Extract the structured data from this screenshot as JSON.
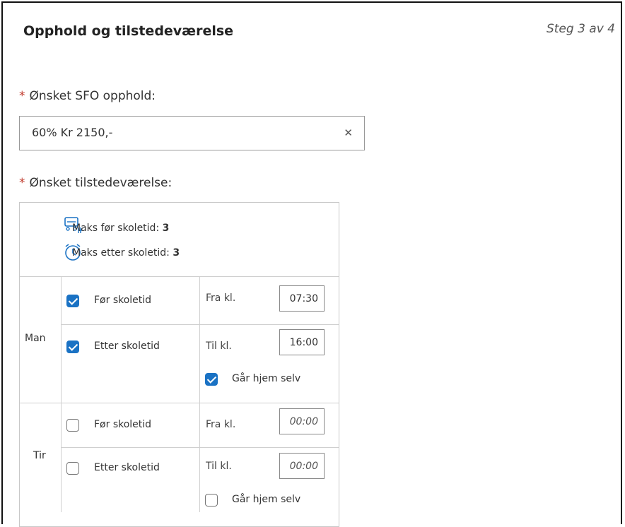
{
  "header": {
    "title": "Opphold og tilstedeværelse",
    "step": "Steg 3 av 4"
  },
  "sfo": {
    "label": "Ønsket SFO opphold:",
    "value": "60%  Kr 2150,-",
    "clear_icon": "close-icon"
  },
  "attendance": {
    "label": "Ønsket tilstedeværelse:",
    "max_before_label": "Maks før skoletid:",
    "max_before_value": "3",
    "max_after_label": "Maks etter skoletid:",
    "max_after_value": "3",
    "days": [
      {
        "day": "Man",
        "before_label": "Før skoletid",
        "before_checked": true,
        "from_label": "Fra kl.",
        "from_value": "07:30",
        "after_label": "Etter skoletid",
        "after_checked": true,
        "to_label": "Til kl.",
        "to_value": "16:00",
        "home_label": "Går hjem selv",
        "home_checked": true
      },
      {
        "day": "Tir",
        "before_label": "Før skoletid",
        "before_checked": false,
        "from_label": "Fra kl.",
        "from_placeholder": "00:00",
        "after_label": "Etter skoletid",
        "after_checked": false,
        "to_label": "Til kl.",
        "to_placeholder": "00:00",
        "home_label": "Går hjem selv",
        "home_checked": false
      }
    ]
  },
  "colors": {
    "accent": "#1a72c4",
    "required": "#c0392b"
  }
}
